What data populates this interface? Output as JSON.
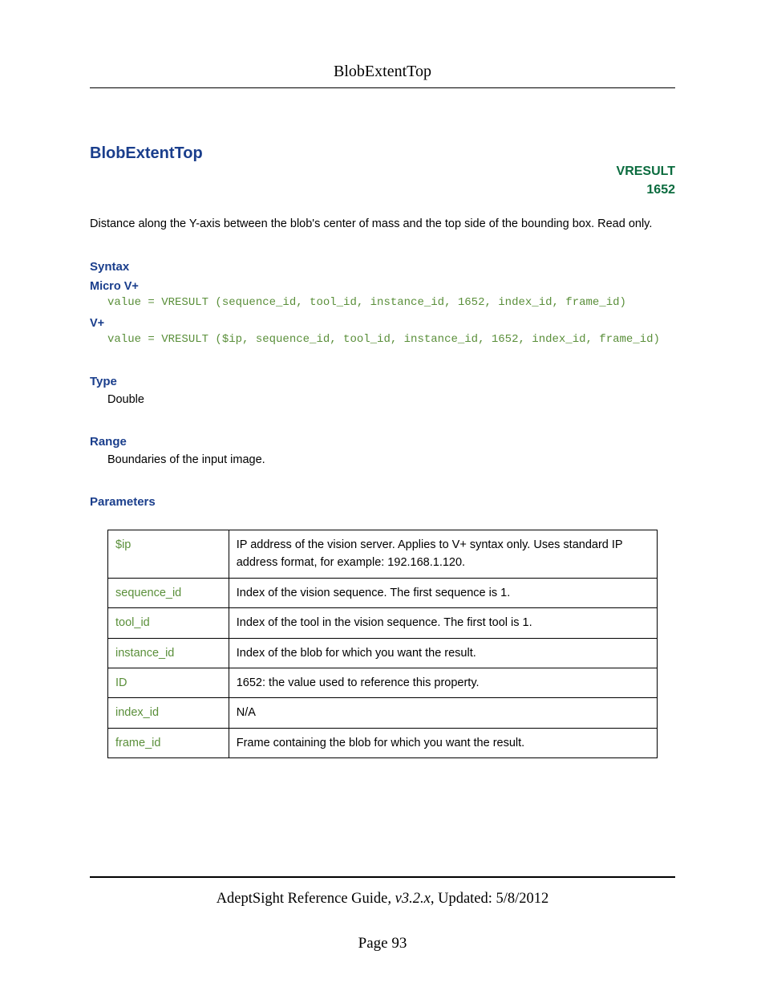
{
  "header": {
    "title": "BlobExtentTop"
  },
  "main": {
    "title": "BlobExtentTop",
    "vresult_label": "VRESULT",
    "vresult_code": "1652",
    "description": "Distance along the Y-axis between the blob's center of mass and the top side of the bounding box. Read only.",
    "syntax": {
      "heading": "Syntax",
      "micro_label": "Micro V+",
      "micro_code": "value = VRESULT (sequence_id, tool_id, instance_id, 1652, index_id, frame_id)",
      "vplus_label": "V+",
      "vplus_code": "value = VRESULT ($ip, sequence_id, tool_id, instance_id, 1652, index_id, frame_id)"
    },
    "type": {
      "heading": "Type",
      "value": "Double"
    },
    "range": {
      "heading": "Range",
      "value": "Boundaries of the input image."
    },
    "parameters": {
      "heading": "Parameters",
      "rows": [
        {
          "name": "$ip",
          "desc": "IP address of the vision server. Applies to V+ syntax only. Uses standard IP address format, for example: 192.168.1.120."
        },
        {
          "name": "sequence_id",
          "desc": "Index of the vision sequence. The first sequence is 1."
        },
        {
          "name": "tool_id",
          "desc": "Index of the tool in the vision sequence. The first tool is 1."
        },
        {
          "name": "instance_id",
          "desc": "Index of the blob for which you want the result."
        },
        {
          "name": "ID",
          "desc": "1652: the value used to reference this property."
        },
        {
          "name": "index_id",
          "desc": "N/A"
        },
        {
          "name": "frame_id",
          "desc": "Frame containing the blob for which you want the result."
        }
      ]
    }
  },
  "footer": {
    "guide": "AdeptSight Reference Guide",
    "version": ", v3.2.x",
    "updated_label": ", Updated: ",
    "updated": "5/8/2012",
    "page_label": "Page ",
    "page_num": "93"
  }
}
